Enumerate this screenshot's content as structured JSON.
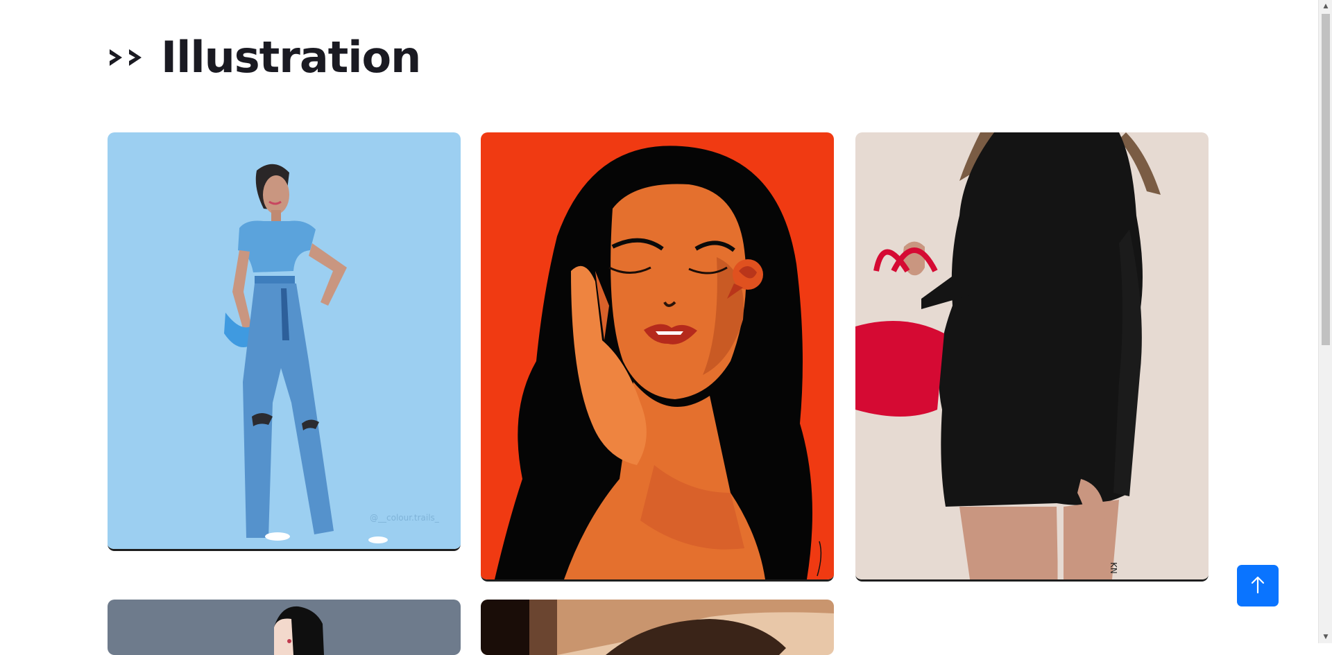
{
  "header": {
    "chevrons": "››",
    "title": "Illustration"
  },
  "gallery": {
    "items": [
      {
        "name": "girl-in-blue-jeans",
        "bg": "#9ccff1",
        "watermark": "@__colour.trails_"
      },
      {
        "name": "woman-with-rose",
        "bg": "#f03a12"
      },
      {
        "name": "woman-in-black-dress",
        "bg": "#e6dad2",
        "signature": "KN"
      },
      {
        "name": "woman-profile-grey",
        "bg": "#6e7b8c"
      },
      {
        "name": "face-closeup",
        "bg": "#e8c7a8"
      }
    ]
  },
  "scroll_to_top": {
    "icon": "arrow-up-icon"
  },
  "colors": {
    "accent": "#0a74ff",
    "title": "#1a1a22"
  }
}
